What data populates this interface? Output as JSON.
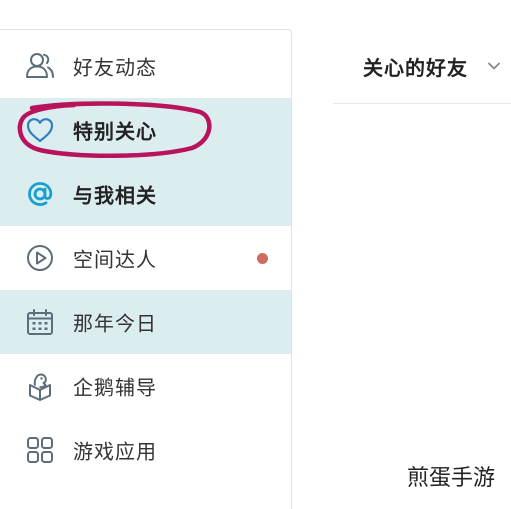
{
  "header": {
    "title": "关心的好友",
    "chevron_icon": "chevron-down-icon"
  },
  "sidebar": {
    "items": [
      {
        "label": "好友动态",
        "icon": "friends-icon",
        "highlighted": false,
        "bold": false
      },
      {
        "label": "特别关心",
        "icon": "heart-icon",
        "highlighted": true,
        "bold": true,
        "circled": true
      },
      {
        "label": "与我相关",
        "icon": "at-icon",
        "highlighted": true,
        "bold": true
      },
      {
        "label": "空间达人",
        "icon": "play-icon",
        "highlighted": false,
        "bold": false,
        "notification_dot": true
      },
      {
        "label": "那年今日",
        "icon": "calendar-icon",
        "highlighted": true,
        "bold": false
      },
      {
        "label": "企鹅辅导",
        "icon": "penguin-box-icon",
        "highlighted": false,
        "bold": false
      },
      {
        "label": "游戏应用",
        "icon": "apps-grid-icon",
        "highlighted": false,
        "bold": false
      }
    ]
  },
  "colors": {
    "highlight_bg": "#dcedf0",
    "icon": "#5c6e78",
    "at_icon": "#1aa0d0",
    "heart_icon": "#2d7fc0",
    "notification_dot": "#cf6b5f",
    "annotation_circle": "#b8145e"
  },
  "watermark": "煎蛋手游"
}
